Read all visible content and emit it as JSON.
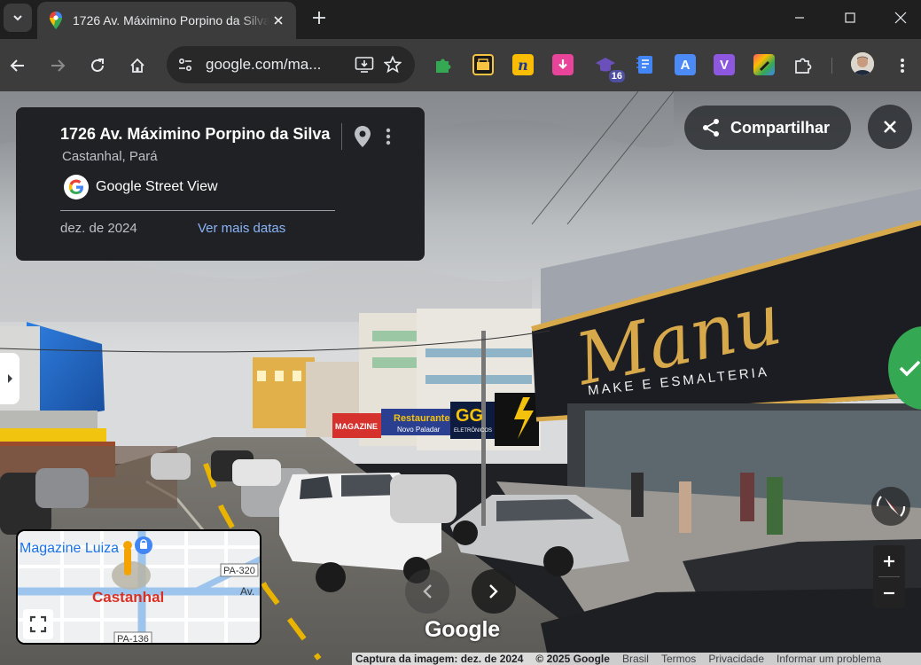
{
  "browser": {
    "tab_title": "1726 Av. Máximino Porpino da Silva",
    "url": "google.com/ma...",
    "extensions": [
      {
        "name": "puzzle-green",
        "color": "#34a853"
      },
      {
        "name": "ext-black-yellow",
        "color": "#f6c342"
      },
      {
        "name": "ext-n",
        "color": "#fbbc04"
      },
      {
        "name": "ext-download",
        "color": "#e8449a"
      },
      {
        "name": "ext-grad-cap",
        "color": "#6b4fbb",
        "badge": "16"
      },
      {
        "name": "ext-doc",
        "color": "#4285f4"
      },
      {
        "name": "ext-a",
        "color": "#4c8bf5"
      },
      {
        "name": "ext-v",
        "color": "#8e57e0"
      },
      {
        "name": "ext-color",
        "color": "#ff5a5f"
      }
    ]
  },
  "card": {
    "title": "1726 Av. Máximino Porpino da Silva",
    "subtitle": "Castanhal, Pará",
    "source_label": "Google Street View",
    "date": "dez. de 2024",
    "more_dates": "Ver mais datas"
  },
  "share_label": "Compartilhar",
  "minimap": {
    "place_label": "Magazine Luiza",
    "city_label": "Castanhal",
    "road_label_1": "PA-320",
    "road_label_2": "PA-136",
    "road_label_3": "Av."
  },
  "scene_text": {
    "shop_sign": "Manu",
    "shop_subsign": "MAKE E ESMALTERIA",
    "restaurant": "Restaurante",
    "restaurant_sub": "Novo Paladar",
    "gg": "GG",
    "gg_sub": "ELETRÔNICOS",
    "red_sign": "MAGAZINE"
  },
  "watermark": "Google",
  "footer": {
    "capture": "Captura da imagem: dez. de 2024",
    "copyright": "© 2025 Google",
    "country": "Brasil",
    "terms": "Termos",
    "privacy": "Privacidade",
    "report": "Informar um problema"
  },
  "colors": {
    "card_bg": "#202124",
    "link": "#8ab4f8",
    "accent_green": "#34a853",
    "shop_gold": "#d8a94a"
  }
}
